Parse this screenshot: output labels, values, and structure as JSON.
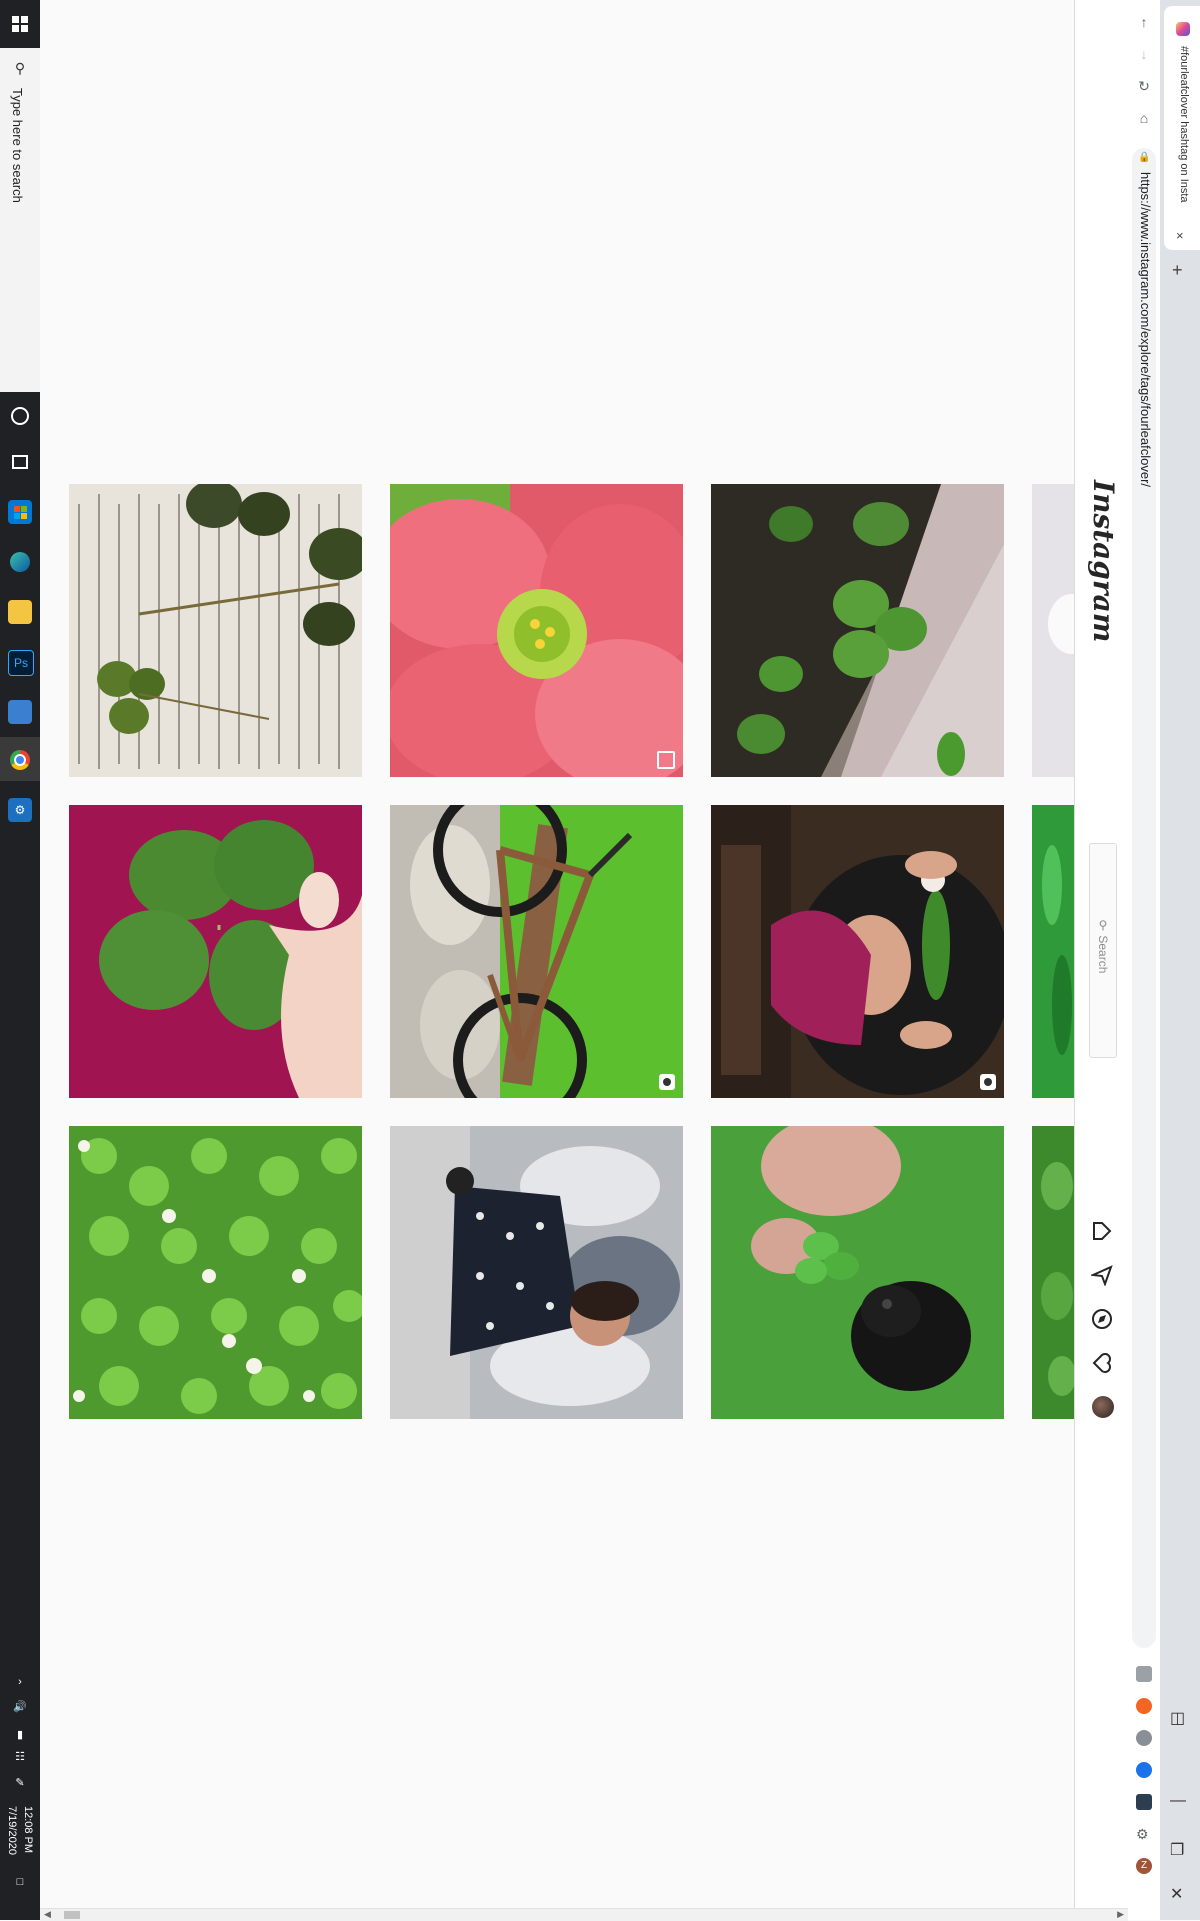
{
  "taskbar": {
    "search_placeholder": "Type here to search",
    "clock_time": "12:08 PM",
    "clock_date": "7/19/2020",
    "apps": [
      "start-icon",
      "task-view-icon",
      "store-icon",
      "edge-icon",
      "file-explorer-icon",
      "photoshop-icon",
      "visual-studio-icon",
      "chrome-icon",
      "settings-icon"
    ]
  },
  "browser": {
    "tab_title": "#fourleafclover hashtag on Insta",
    "url": "https://www.instagram.com/explore/tags/fourleafclover/",
    "new_tab_label": "+",
    "close_tab_label": "×"
  },
  "instagram": {
    "logo_text": "Instagram",
    "search_placeholder": "Search",
    "nav_icons": [
      "home-icon",
      "direct-icon",
      "explore-icon",
      "activity-icon",
      "profile-avatar"
    ]
  },
  "grid": {
    "rows": 3,
    "cols": 3,
    "images": [
      {
        "name": "pressed-clover-on-newspaper",
        "badge": "none"
      },
      {
        "name": "pink-oxalis-flower",
        "badge": "multiple"
      },
      {
        "name": "clover-in-planter",
        "badge": "none"
      },
      {
        "name": "four-leaf-clover-held-on-magenta",
        "badge": "none"
      },
      {
        "name": "bicycle-on-grass",
        "badge": "video"
      },
      {
        "name": "woman-holding-leaf",
        "badge": "video"
      },
      {
        "name": "clover-patch-with-flowers",
        "badge": "none"
      },
      {
        "name": "child-in-polka-dot-dress",
        "badge": "none"
      },
      {
        "name": "hand-holding-clover-with-dog",
        "badge": "none"
      }
    ]
  },
  "colors": {
    "taskbar_bg": "#202124",
    "page_bg": "#fafafa",
    "ig_border": "#dbdbdb",
    "chrome_tabstrip": "#dee1e6"
  }
}
